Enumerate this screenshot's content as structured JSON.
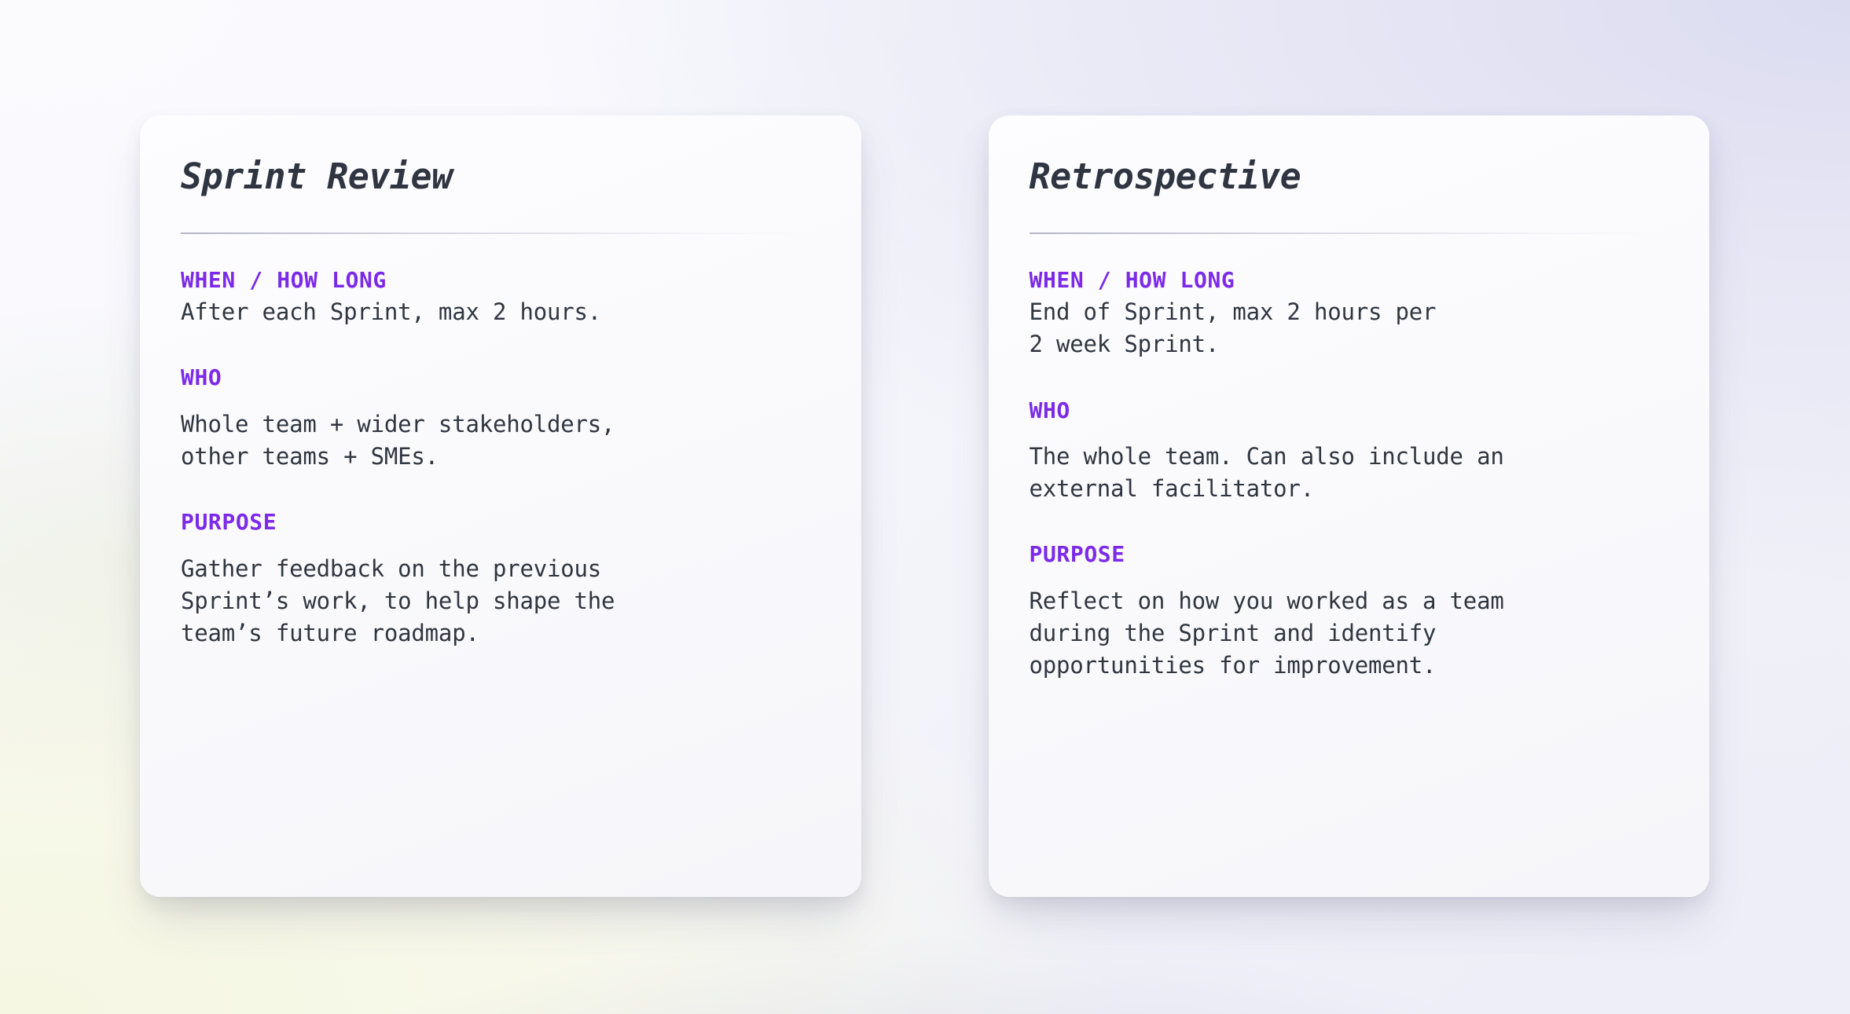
{
  "theme": {
    "accent_purple": "#7c2ae8",
    "body_text": "#2f3640",
    "title_text": "#2f3541",
    "card_background": "#fbfbfe",
    "page_background_lavender": "#dcdcf1",
    "page_background_cream": "#f5f7e2"
  },
  "cards": [
    {
      "title": "Sprint Review",
      "sections": [
        {
          "label": "WHEN / HOW LONG",
          "body": "After each Sprint, max 2 hours.",
          "spacing": "tight"
        },
        {
          "label": "WHO",
          "body": "Whole team + wider stakeholders,\nother teams + SMEs.",
          "spacing": "loose"
        },
        {
          "label": "PURPOSE",
          "body": "Gather feedback on the previous\nSprint’s work, to help shape the\nteam’s future roadmap.",
          "spacing": "loose"
        }
      ]
    },
    {
      "title": "Retrospective",
      "sections": [
        {
          "label": "WHEN / HOW LONG",
          "body": "End of Sprint, max 2 hours per\n2 week Sprint.",
          "spacing": "tight"
        },
        {
          "label": "WHO",
          "body": "The whole team. Can also include an\nexternal facilitator.",
          "spacing": "loose"
        },
        {
          "label": "PURPOSE",
          "body": "Reflect on how you worked as a team\nduring the Sprint and identify\nopportunities for improvement.",
          "spacing": "loose"
        }
      ]
    }
  ]
}
